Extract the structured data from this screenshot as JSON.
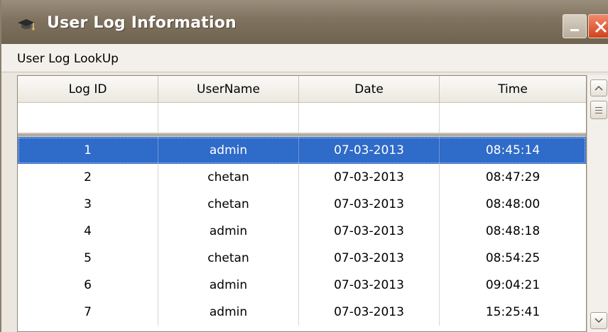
{
  "window": {
    "title": "User Log Information",
    "icon": "graduation-cap-icon",
    "minimize_icon": "minimize-icon",
    "close_icon": "close-icon"
  },
  "panel": {
    "label": "User Log LookUp"
  },
  "grid": {
    "columns": [
      "Log ID",
      "UserName",
      "Date",
      "Time"
    ],
    "selected_row_index": 0,
    "rows": [
      {
        "log_id": "1",
        "username": "admin",
        "date": "07-03-2013",
        "time": "08:45:14"
      },
      {
        "log_id": "2",
        "username": "chetan",
        "date": "07-03-2013",
        "time": "08:47:29"
      },
      {
        "log_id": "3",
        "username": "chetan",
        "date": "07-03-2013",
        "time": "08:48:00"
      },
      {
        "log_id": "4",
        "username": "admin",
        "date": "07-03-2013",
        "time": "08:48:18"
      },
      {
        "log_id": "5",
        "username": "chetan",
        "date": "07-03-2013",
        "time": "08:54:25"
      },
      {
        "log_id": "6",
        "username": "admin",
        "date": "07-03-2013",
        "time": "09:04:21"
      },
      {
        "log_id": "7",
        "username": "admin",
        "date": "07-03-2013",
        "time": "15:25:41"
      }
    ]
  },
  "colors": {
    "selection": "#2f6bc8",
    "titlebar": "#7f735f",
    "close_button": "#d2421e"
  }
}
